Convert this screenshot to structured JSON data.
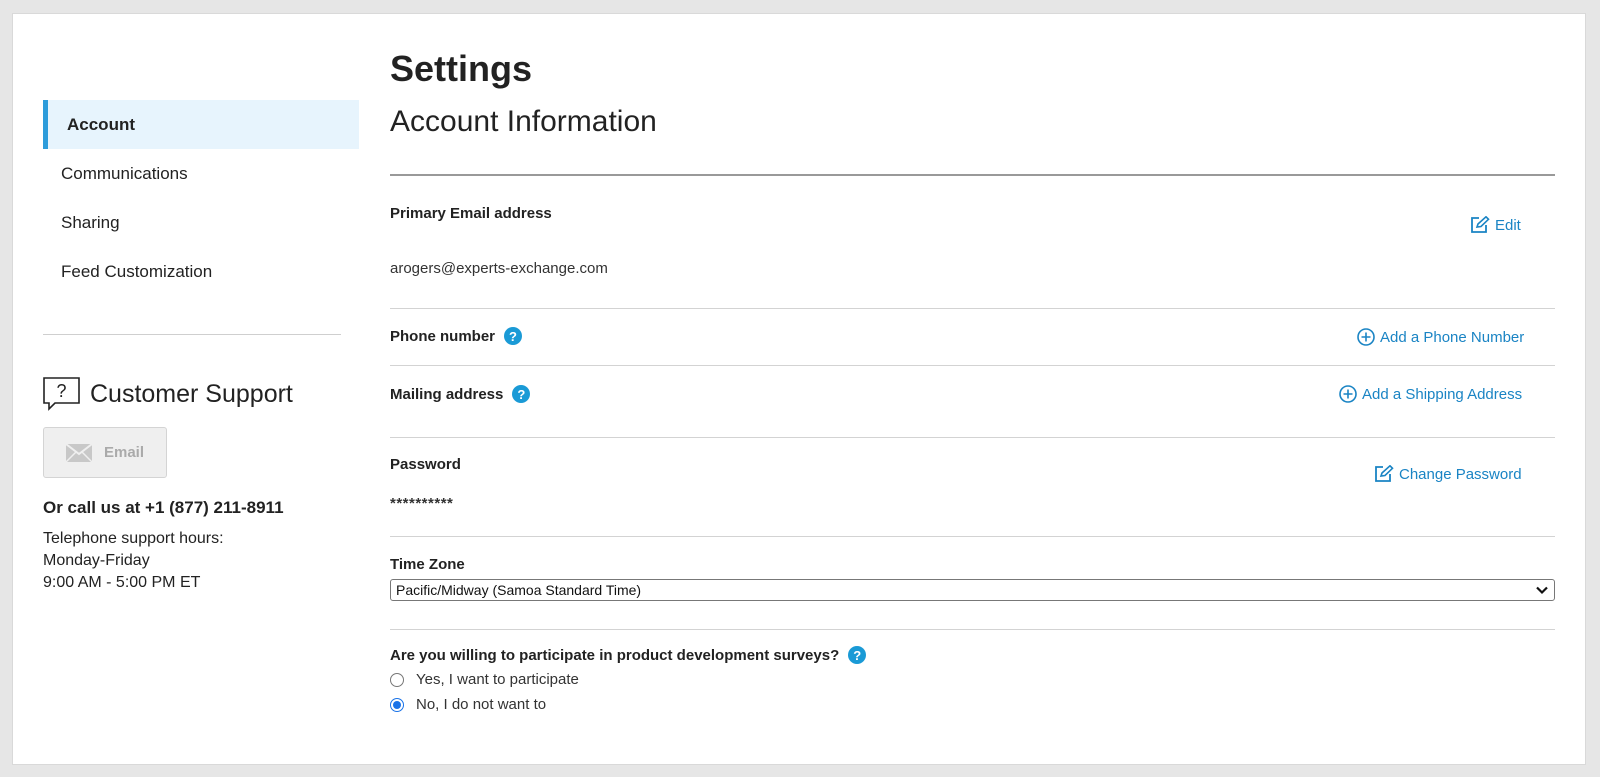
{
  "sidebar": {
    "items": [
      {
        "label": "Account"
      },
      {
        "label": "Communications"
      },
      {
        "label": "Sharing"
      },
      {
        "label": "Feed Customization"
      }
    ],
    "support": {
      "title": "Customer Support",
      "email_label": "Email",
      "call": "Or call us at +1 (877) 211-8911",
      "hours_line1": "Telephone support hours:",
      "hours_line2": "Monday-Friday",
      "hours_line3": "9:00 AM - 5:00 PM ET"
    }
  },
  "main": {
    "page_title": "Settings",
    "section_title": "Account Information",
    "email": {
      "label": "Primary Email address",
      "value": "arogers@experts-exchange.com",
      "action": "Edit"
    },
    "phone": {
      "label": "Phone number",
      "action": "Add a Phone Number"
    },
    "mailing": {
      "label": "Mailing address",
      "action": "Add a Shipping Address"
    },
    "password": {
      "label": "Password",
      "value": "**********",
      "action": "Change Password"
    },
    "timezone": {
      "label": "Time Zone",
      "selected": "Pacific/Midway (Samoa Standard Time)"
    },
    "survey": {
      "question": "Are you willing to participate in product development surveys?",
      "options": [
        {
          "label": "Yes, I want to participate",
          "checked": false
        },
        {
          "label": "No, I do not want to",
          "checked": true
        }
      ]
    }
  },
  "icons": {
    "help": "?",
    "accent": "#1a84c4",
    "active_border": "#2d9cdb"
  }
}
